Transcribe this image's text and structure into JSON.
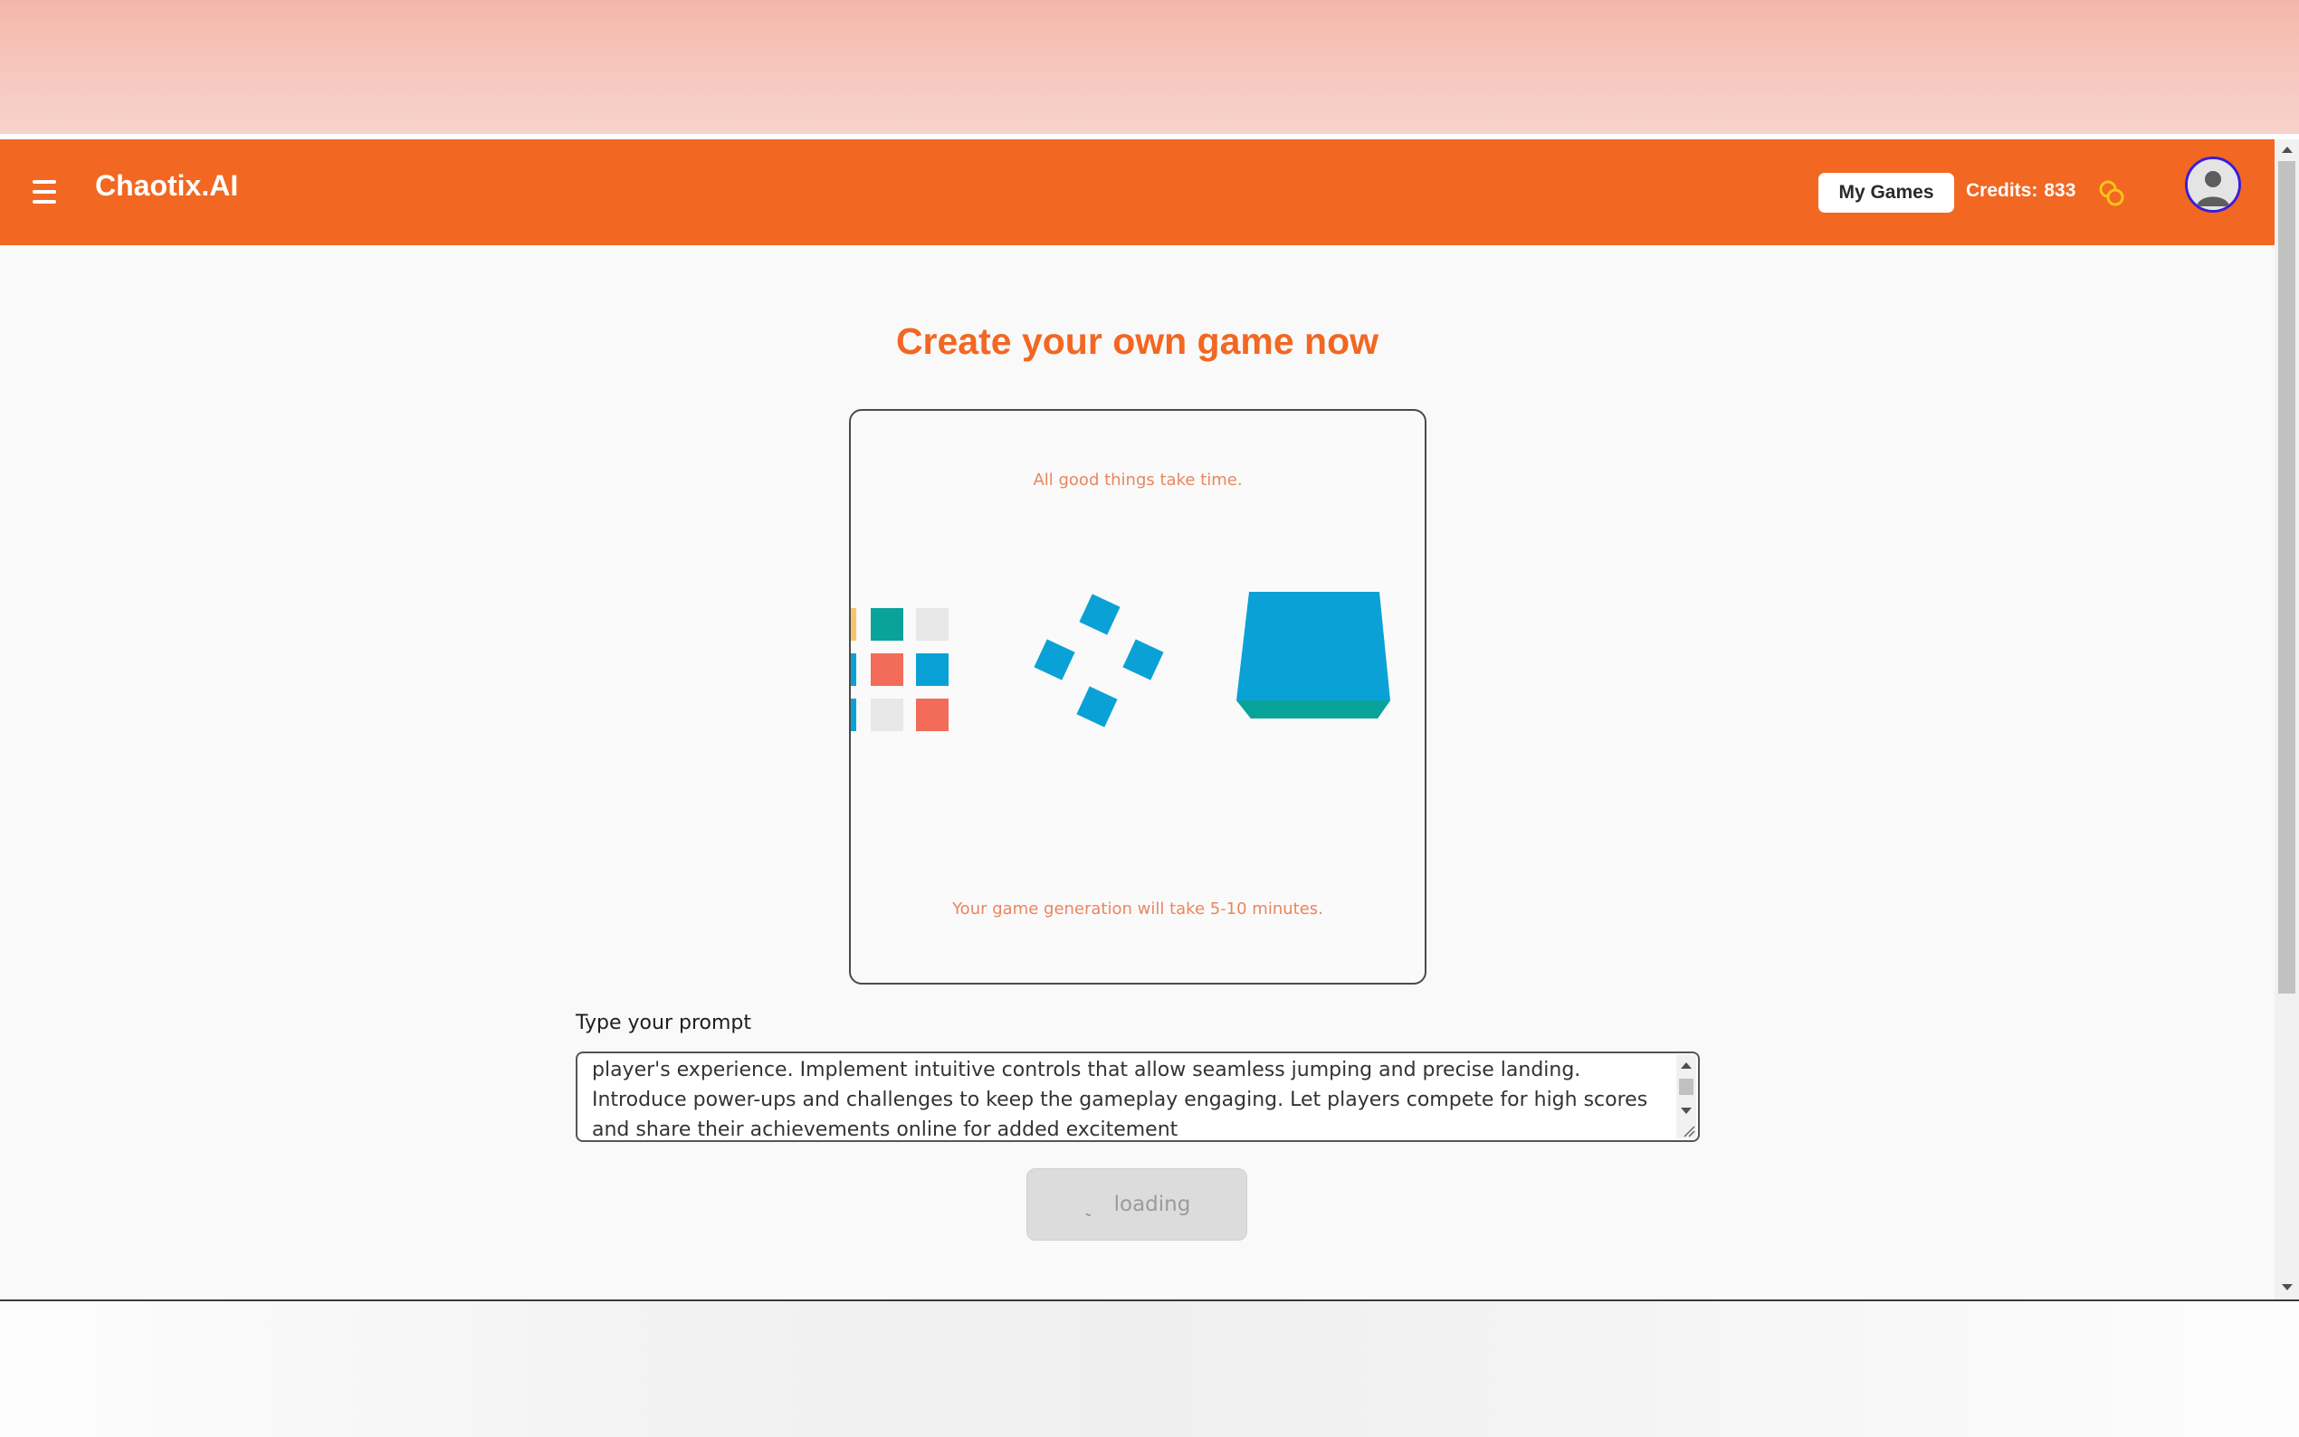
{
  "navbar": {
    "brand": "Chaotix.AI",
    "my_games_label": "My Games",
    "credits_label": "Credits:",
    "credits_value": "833",
    "accent_color": "#f26722",
    "menu_icon": "hamburger-menu-icon",
    "coin_icon": "coins-icon",
    "avatar_icon": "user-avatar-icon"
  },
  "main": {
    "title": "Create your own game now",
    "loader": {
      "top_text": "All good things take time.",
      "bottom_text": "Your game generation will take 5-10 minutes.",
      "palette": [
        "#f6c56b",
        "#0aa39a",
        "#e8e8e8",
        "#f36c5a",
        "#0aa2d6"
      ]
    },
    "prompt": {
      "label": "Type your prompt",
      "value": "player's experience. Implement intuitive controls that allow seamless jumping and precise landing. Introduce power-ups and challenges to keep the gameplay engaging. Let players compete for high scores and share their achievements online for added excitement"
    },
    "submit": {
      "label": "loading",
      "icon": "spinner-icon",
      "disabled": true
    }
  }
}
